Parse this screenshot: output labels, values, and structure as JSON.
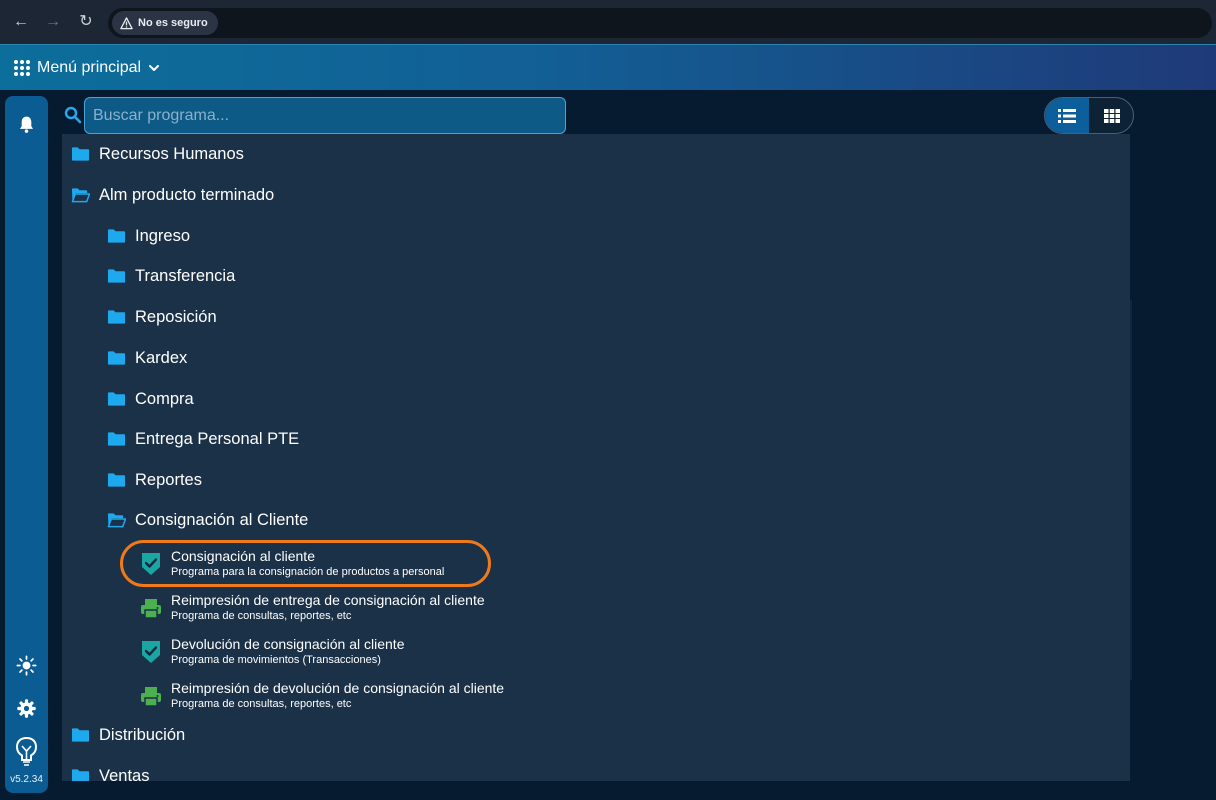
{
  "browser": {
    "security_label": "No es seguro"
  },
  "header": {
    "menu_label": "Menú principal"
  },
  "search": {
    "placeholder": "Buscar programa..."
  },
  "rail": {
    "version": "v5.2.34"
  },
  "tree": {
    "folders": [
      {
        "label": "Recursos Humanos",
        "open": false
      },
      {
        "label": "Alm producto terminado",
        "open": true
      },
      {
        "label": "Ingreso",
        "open": false
      },
      {
        "label": "Transferencia",
        "open": false
      },
      {
        "label": "Reposición",
        "open": false
      },
      {
        "label": "Kardex",
        "open": false
      },
      {
        "label": "Compra",
        "open": false
      },
      {
        "label": "Entrega Personal PTE",
        "open": false
      },
      {
        "label": "Reportes",
        "open": false
      },
      {
        "label": "Consignación al Cliente",
        "open": true
      },
      {
        "label": "Distribución",
        "open": false
      },
      {
        "label": "Ventas",
        "open": false
      }
    ],
    "programs": [
      {
        "title": "Consignación al cliente",
        "description": "Programa para la consignación de productos a personal",
        "icon": "shield-check-icon",
        "highlighted": true
      },
      {
        "title": "Reimpresión de entrega de consignación al cliente",
        "description": "Programa de consultas, reportes, etc",
        "icon": "printer-icon",
        "highlighted": false
      },
      {
        "title": "Devolución de consignación al cliente",
        "description": "Programa de movimientos (Transacciones)",
        "icon": "shield-check-icon",
        "highlighted": false
      },
      {
        "title": "Reimpresión de devolución de consignación al cliente",
        "description": "Programa de consultas, reportes, etc",
        "icon": "printer-icon",
        "highlighted": false
      }
    ]
  },
  "colors": {
    "folder": "#1ea8ee",
    "shield": "#1aa7a4",
    "printer": "#4caf50",
    "highlight": "#f07a1a"
  }
}
